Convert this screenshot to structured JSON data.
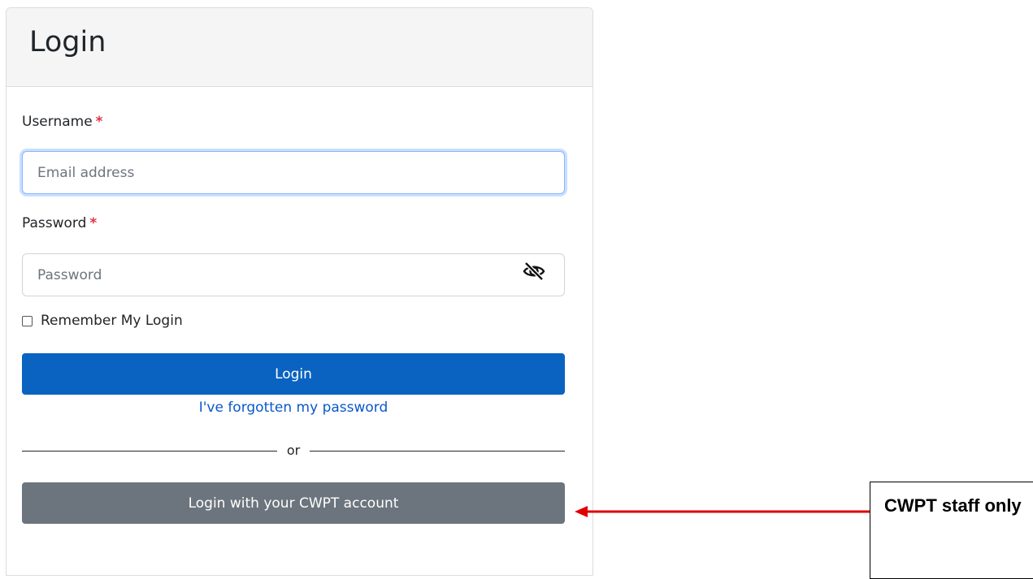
{
  "card": {
    "title": "Login"
  },
  "username": {
    "label": "Username",
    "required_mark": "*",
    "placeholder": "Email address",
    "value": ""
  },
  "password": {
    "label": "Password",
    "required_mark": "*",
    "placeholder": "Password",
    "value": "",
    "toggle_icon": "eye-slash-icon"
  },
  "remember": {
    "label": "Remember My Login",
    "checked": false
  },
  "login_button": {
    "label": "Login"
  },
  "forgot_link": {
    "label": "I've forgotten my password"
  },
  "divider": {
    "text": "or"
  },
  "sso_button": {
    "label": "Login with your CWPT account"
  },
  "annotation": {
    "text": "CWPT staff only",
    "arrow_color": "#e00000"
  },
  "colors": {
    "primary": "#0a63c0",
    "secondary": "#6c757d",
    "required": "#dc3545",
    "link": "#0a58ca"
  }
}
